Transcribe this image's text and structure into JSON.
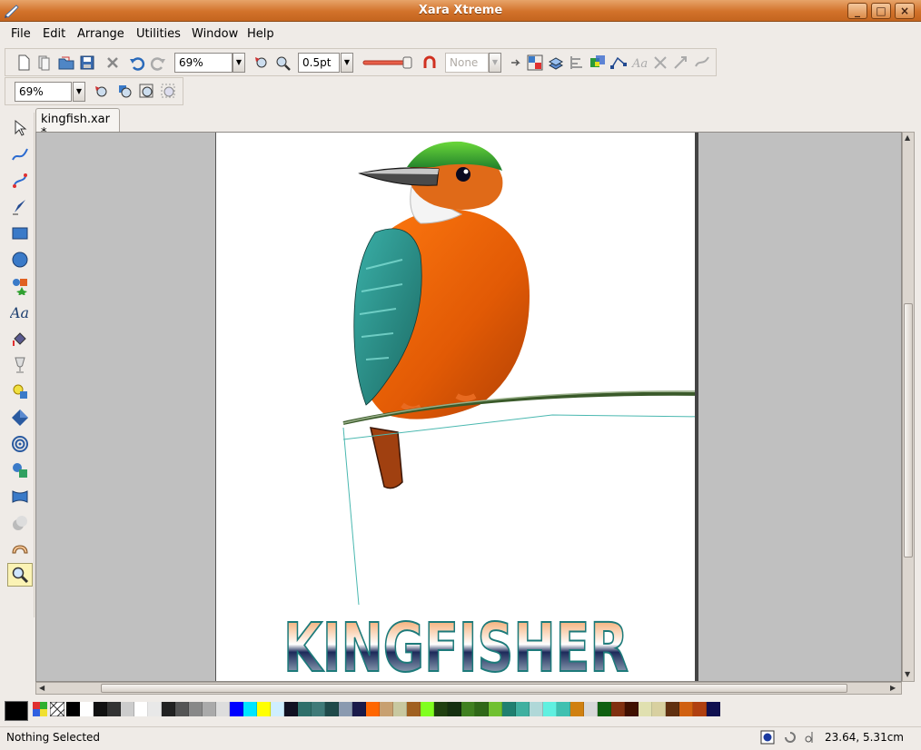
{
  "window": {
    "title": "Xara Xtreme",
    "minimize_glyph": "_",
    "maximize_glyph": "□",
    "close_glyph": "×"
  },
  "menu": [
    "File",
    "Edit",
    "Arrange",
    "Utilities",
    "Window",
    "Help"
  ],
  "toolbar": {
    "zoom_value": "69%",
    "line_width": "0.5pt",
    "arrowhead": "None",
    "zoom_value_2": "69%"
  },
  "document": {
    "tab_label": "kingfish.xar *"
  },
  "artwork": {
    "heading": "KINGFISHER"
  },
  "status": {
    "text": "Nothing Selected",
    "coordinates": "23.64, 5.31cm"
  },
  "palette": [
    "#000000",
    "#ffffff",
    "#111111",
    "#333333",
    "#cccccc",
    "#ffffff",
    "#e8e8e8",
    "#222222",
    "#555555",
    "#888888",
    "#aaaaaa",
    "#dddddd",
    "#0000ff",
    "#00e5ff",
    "#ffff00",
    "#cfeeff",
    "#111122",
    "#2f6f6a",
    "#3f7a78",
    "#1f4a4a",
    "#8a9ab0",
    "#1a1a4a",
    "#ff6600",
    "#c8a070",
    "#c8c8a0",
    "#a06020",
    "#80ff20",
    "#204010",
    "#153010",
    "#408020",
    "#306818",
    "#70c030",
    "#208070",
    "#40b0a0",
    "#b0d8d8",
    "#60f0e0",
    "#40c0b0",
    "#d08010",
    "#d8d8d8",
    "#106010",
    "#803010",
    "#401000",
    "#e0e0b0",
    "#d8d0a0",
    "#603010",
    "#d06010",
    "#b04010",
    "#101050"
  ]
}
